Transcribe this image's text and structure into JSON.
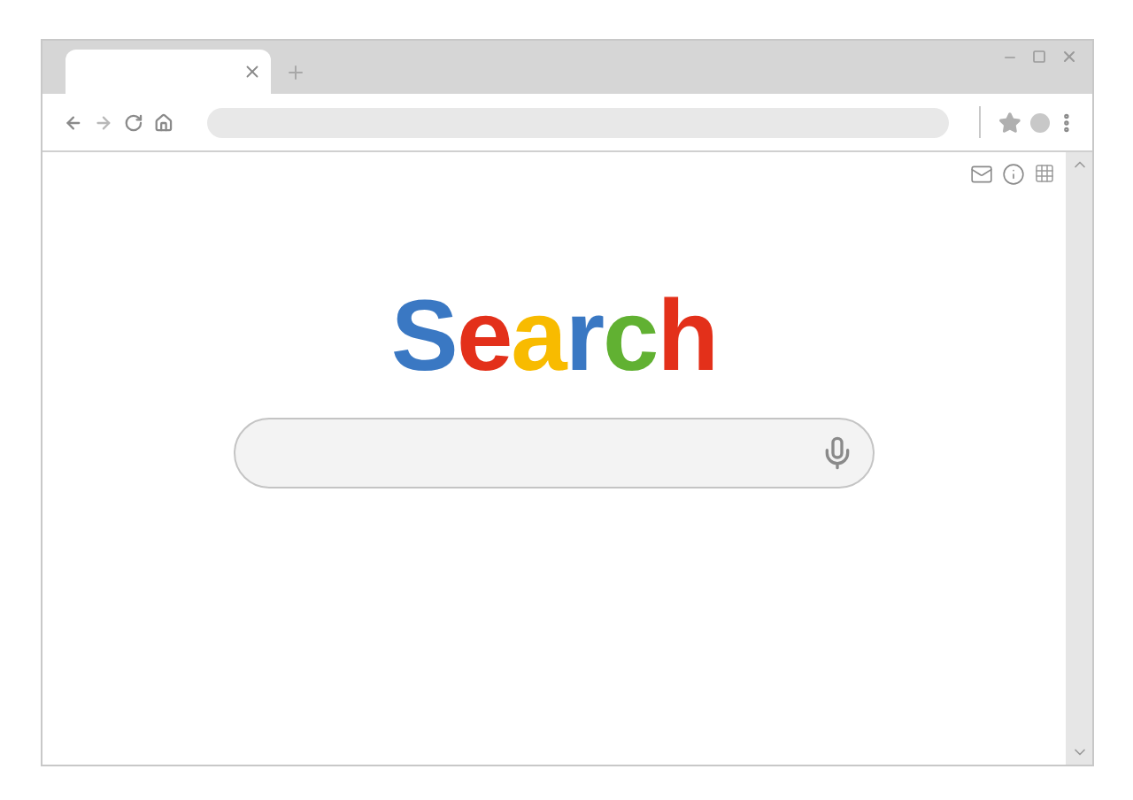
{
  "logo": {
    "letters": [
      {
        "text": "S",
        "color": "#3a78c3"
      },
      {
        "text": "e",
        "color": "#e3301a"
      },
      {
        "text": "a",
        "color": "#f8bb00"
      },
      {
        "text": "r",
        "color": "#3a78c3"
      },
      {
        "text": "c",
        "color": "#61b132"
      },
      {
        "text": "h",
        "color": "#e3301a"
      }
    ]
  }
}
